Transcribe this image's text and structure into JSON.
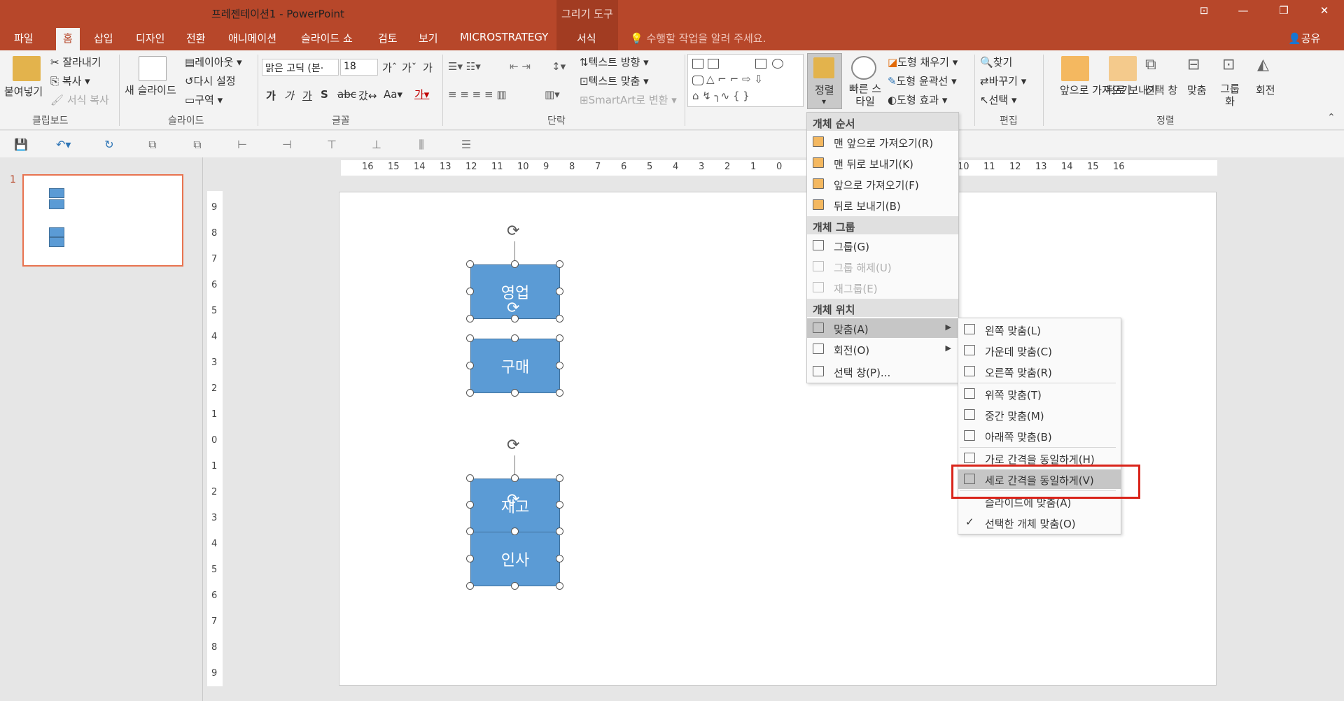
{
  "titlebar": {
    "title": "프레젠테이션1 - PowerPoint",
    "context_tools": "그리기 도구",
    "share": "공유",
    "tell_me": "수행할 작업을 알려 주세요."
  },
  "tabs": [
    "파일",
    "홈",
    "삽입",
    "디자인",
    "전환",
    "애니메이션",
    "슬라이드 쇼",
    "검토",
    "보기",
    "MICROSTRATEGY",
    "서식"
  ],
  "ribbon": {
    "clipboard": {
      "paste": "붙여넣기",
      "cut": "잘라내기",
      "copy": "복사",
      "format_painter": "서식 복사",
      "group": "클립보드"
    },
    "slides": {
      "new_slide": "새 슬라이드",
      "layout": "레이아웃",
      "reset": "다시 설정",
      "section": "구역",
      "group": "슬라이드"
    },
    "font": {
      "font_name": "맑은 고딕 (본·",
      "font_size": "18",
      "group": "글꼴"
    },
    "paragraph": {
      "text_direction": "텍스트 방향",
      "align_text": "텍스트 맞춤",
      "smartart": "SmartArt로 변환",
      "group": "단락"
    },
    "drawing": {
      "arrange": "정렬",
      "quick_styles": "빠른 스타일",
      "fill": "도형 채우기",
      "outline": "도형 윤곽선",
      "effects": "도형 효과"
    },
    "editing": {
      "find": "찾기",
      "replace": "바꾸기",
      "select": "선택",
      "group": "편집"
    },
    "arrange": {
      "bring_forward": "앞으로 가져오기",
      "send_backward": "뒤로 보내기",
      "selection_pane": "선택 창",
      "align": "맞춤",
      "group_btn": "그룹화",
      "rotate": "회전",
      "group": "정렬"
    }
  },
  "slide_panel": {
    "slide_number": "1"
  },
  "ruler": {
    "horizontal": [
      "16",
      "15",
      "14",
      "13",
      "12",
      "11",
      "10",
      "9",
      "8",
      "7",
      "6",
      "5",
      "4",
      "3",
      "2",
      "1",
      "0",
      "7",
      "8",
      "9",
      "10",
      "11",
      "12",
      "13",
      "14",
      "15",
      "16"
    ],
    "vertical": [
      "9",
      "8",
      "7",
      "6",
      "5",
      "4",
      "3",
      "2",
      "1",
      "0",
      "1",
      "2",
      "3",
      "4",
      "5",
      "6",
      "7",
      "8",
      "9"
    ]
  },
  "shapes": [
    "영업",
    "구매",
    "재고",
    "인사"
  ],
  "arrange_menu": {
    "order_header": "개체 순서",
    "bring_to_front": "맨 앞으로 가져오기(R)",
    "send_to_back": "맨 뒤로 보내기(K)",
    "bring_forward": "앞으로 가져오기(F)",
    "send_backward": "뒤로 보내기(B)",
    "group_header": "개체 그룹",
    "group": "그룹(G)",
    "ungroup": "그룹 해제(U)",
    "regroup": "재그룹(E)",
    "position_header": "개체 위치",
    "align": "맞춤(A)",
    "rotate": "회전(O)",
    "selection_pane": "선택 창(P)..."
  },
  "align_submenu": {
    "align_left": "왼쪽 맞춤(L)",
    "align_center": "가운데 맞춤(C)",
    "align_right": "오른쪽 맞춤(R)",
    "align_top": "위쪽 맞춤(T)",
    "align_middle": "중간 맞춤(M)",
    "align_bottom": "아래쪽 맞춤(B)",
    "distribute_h": "가로 간격을 동일하게(H)",
    "distribute_v": "세로 간격을 동일하게(V)",
    "align_to_slide": "슬라이드에 맞춤(A)",
    "align_selected": "선택한 개체 맞춤(O)",
    "check_mark": "✓"
  },
  "colors": {
    "accent": "#b7472a",
    "shape_fill": "#5b9bd5",
    "highlight_box": "#d9241a"
  }
}
